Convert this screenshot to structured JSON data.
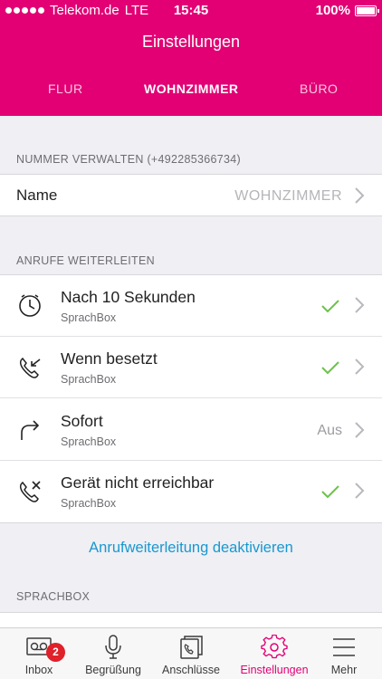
{
  "status_bar": {
    "carrier": "Telekom.de",
    "network": "LTE",
    "time": "15:45",
    "battery": "100%"
  },
  "header": {
    "title": "Einstellungen",
    "tabs": [
      {
        "label": "FLUR",
        "active": false
      },
      {
        "label": "WOHNZIMMER",
        "active": true
      },
      {
        "label": "BÜRO",
        "active": false
      }
    ]
  },
  "number_section": {
    "label": "NUMMER VERWALTEN (+492285366734)",
    "name_label": "Name",
    "name_value": "WOHNZIMMER"
  },
  "forward_section": {
    "label": "ANRUFE WEITERLEITEN",
    "rows": [
      {
        "icon": "clock-icon",
        "title": "Nach 10 Sekunden",
        "subtitle": "SprachBox",
        "state": "check"
      },
      {
        "icon": "phone-busy-icon",
        "title": "Wenn besetzt",
        "subtitle": "SprachBox",
        "state": "check"
      },
      {
        "icon": "forward-arrow-icon",
        "title": "Sofort",
        "subtitle": "SprachBox",
        "state": "text",
        "state_text": "Aus"
      },
      {
        "icon": "phone-unreachable-icon",
        "title": "Gerät nicht erreichbar",
        "subtitle": "SprachBox",
        "state": "check"
      }
    ],
    "deactivate_label": "Anrufweiterleitung deaktivieren"
  },
  "sprachbox_section": {
    "label": "SPRACHBOX"
  },
  "tabbar": {
    "items": [
      {
        "label": "Inbox",
        "icon": "voicemail-icon",
        "badge": "2",
        "active": false
      },
      {
        "label": "Begrüßung",
        "icon": "microphone-icon",
        "active": false
      },
      {
        "label": "Anschlüsse",
        "icon": "phones-icon",
        "active": false
      },
      {
        "label": "Einstellungen",
        "icon": "gear-icon",
        "active": true
      },
      {
        "label": "Mehr",
        "icon": "menu-icon",
        "active": false
      }
    ]
  },
  "colors": {
    "brand": "#e20074",
    "link": "#1998cf",
    "check": "#6cc24a",
    "badge": "#e0202a"
  }
}
